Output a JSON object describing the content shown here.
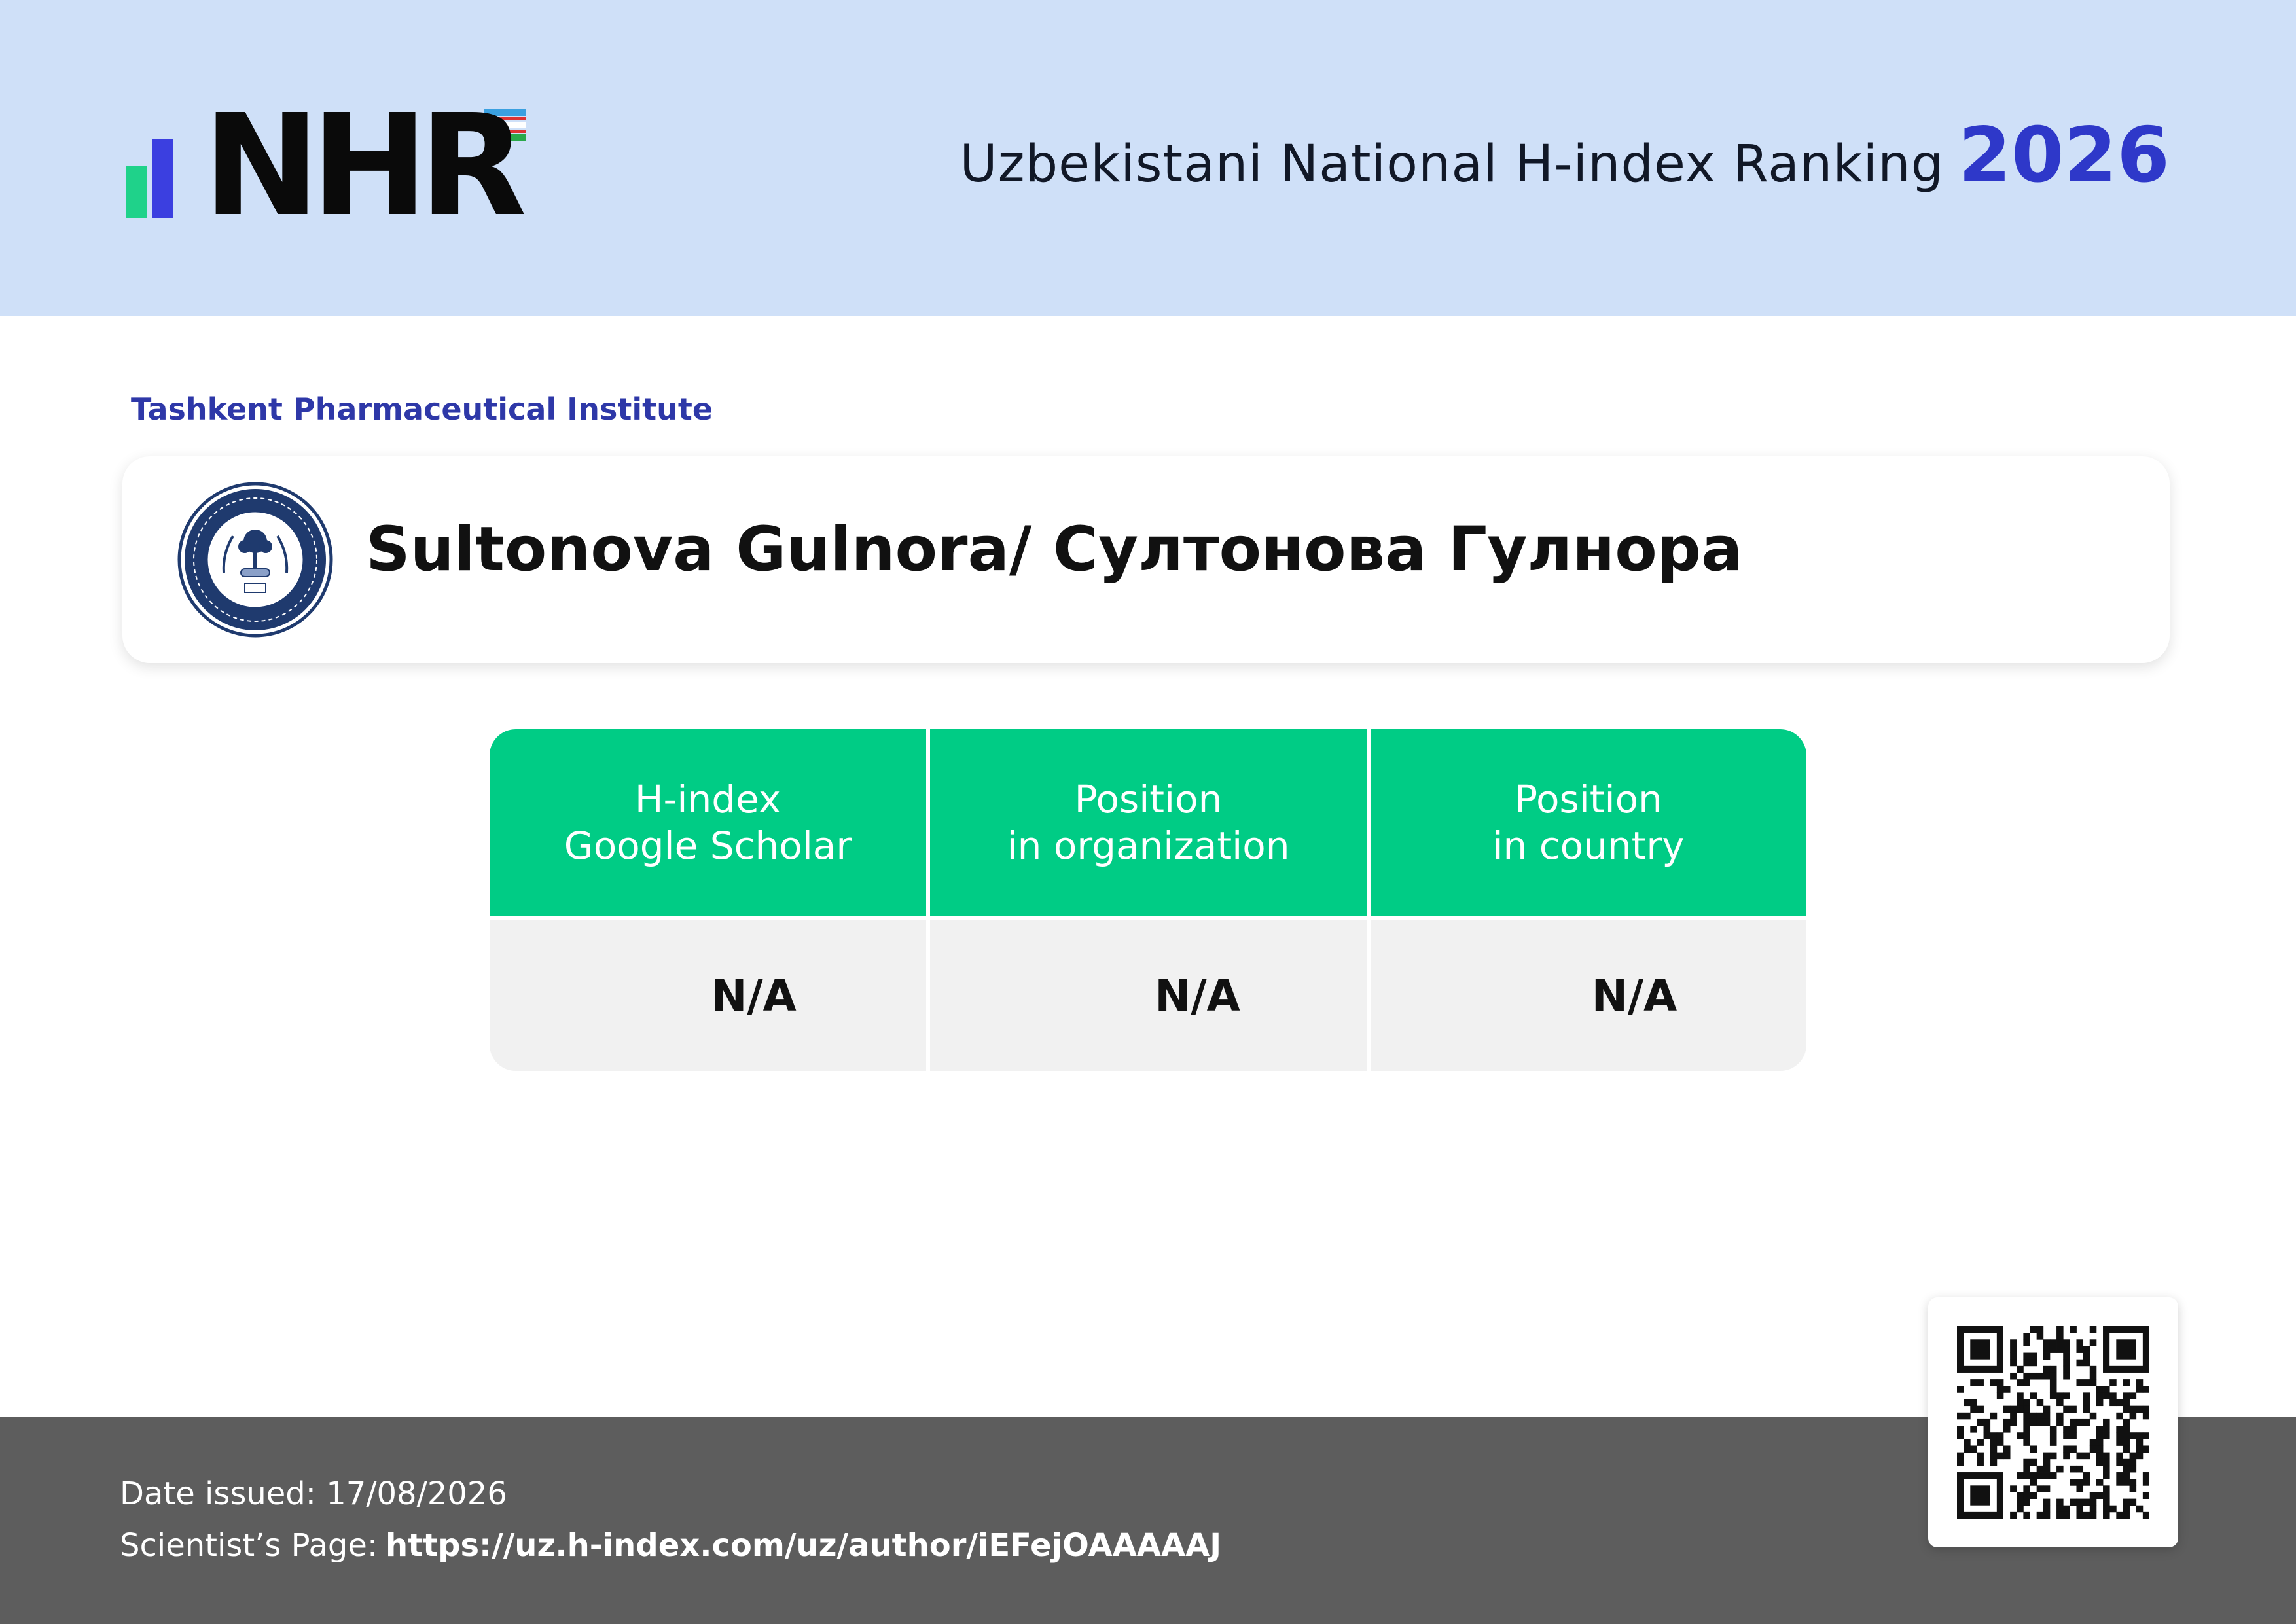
{
  "header": {
    "logo_text": "NHR",
    "title": "Uzbekistani National H-index Ranking",
    "year": "2026"
  },
  "organization": "Tashkent Pharmaceutical Institute",
  "person": {
    "name": "Sultonova Gulnora/ Султонова Гулнора"
  },
  "table": {
    "columns": [
      {
        "line1": "H-index",
        "line2": "Google Scholar",
        "value": "N/A"
      },
      {
        "line1": "Position",
        "line2": "in organization",
        "value": "N/A"
      },
      {
        "line1": "Position",
        "line2": "in country",
        "value": "N/A"
      }
    ]
  },
  "footer": {
    "date_label": "Date issued:",
    "date_value": "17/08/2026",
    "page_label": "Scientist’s Page:",
    "page_url": "https://uz.h-index.com/uz/author/iEFejOAAAAAJ"
  },
  "colors": {
    "header_bg": "#cfe0f8",
    "accent_blue": "#2e38c9",
    "accent_green": "#00cc85",
    "footer_bg": "#5d5d5d"
  },
  "icons": {
    "logo": "nhr-logo-icon",
    "seal": "institute-seal-icon",
    "qr": "qr-code-icon"
  }
}
